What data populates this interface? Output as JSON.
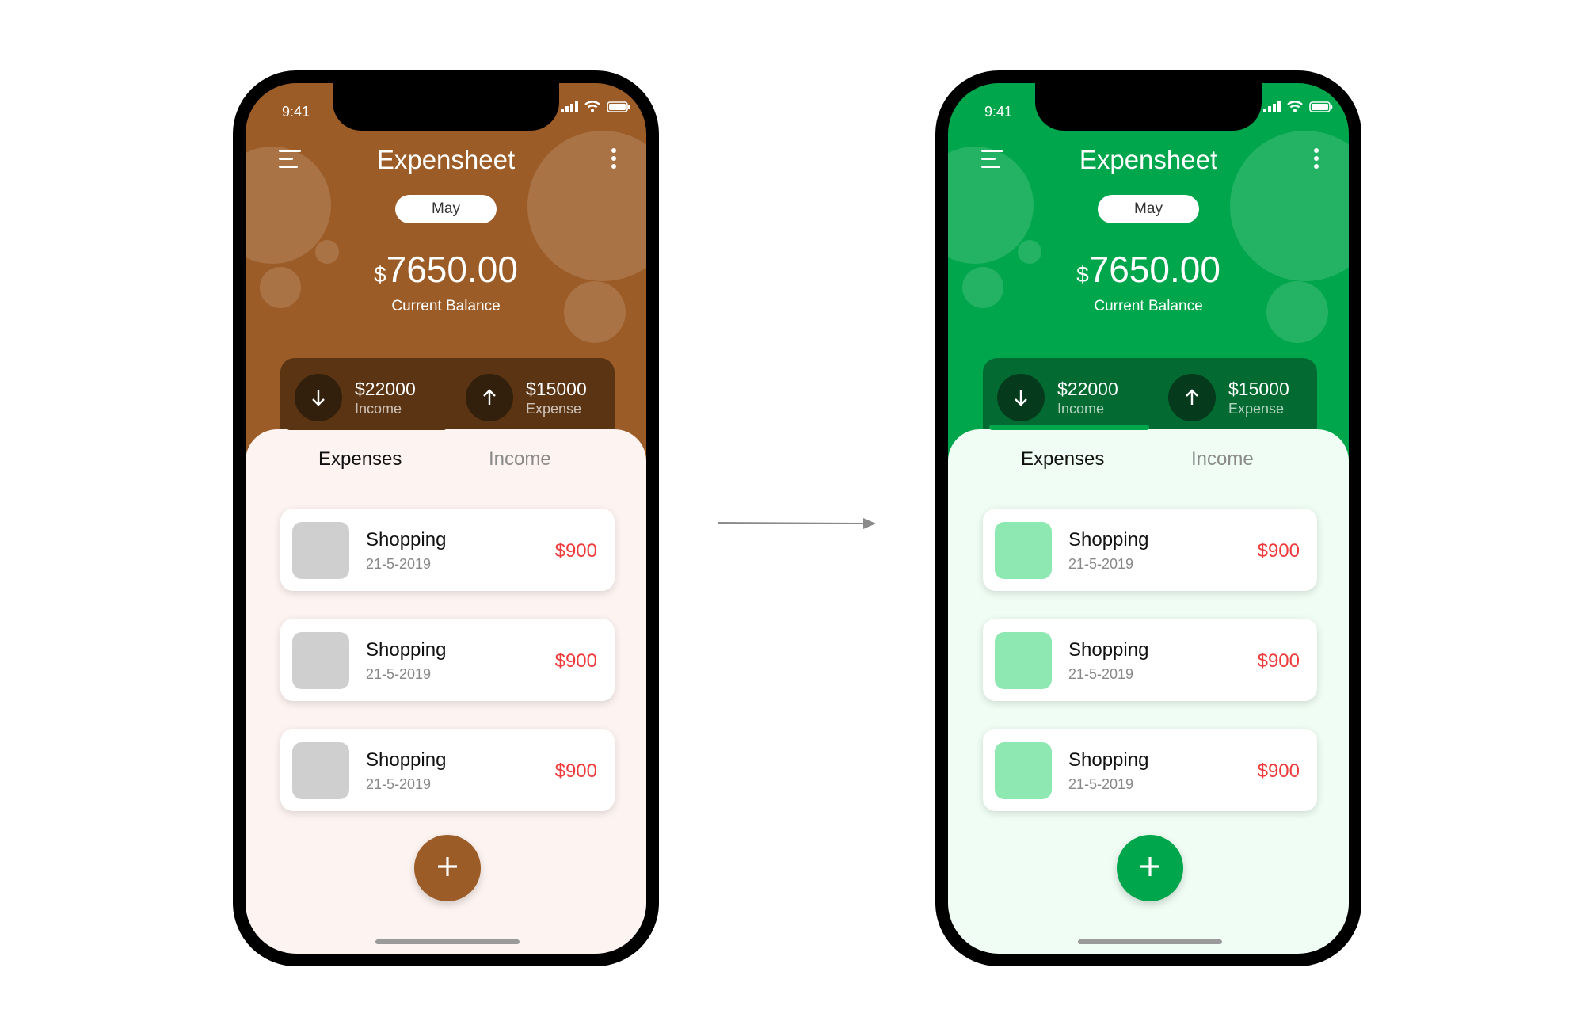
{
  "arrow": {
    "icon": "arrow-right-icon"
  },
  "phones": [
    {
      "theme": {
        "header": "#9c5c27",
        "summary": "#5a3413",
        "circle": "#33200c",
        "panel": "#fdf3f1",
        "thumb": "#cfcfcf",
        "fab": "#9c5c27",
        "indicator": "#5a3413"
      },
      "status": {
        "time": "9:41",
        "icons": [
          "signal-icon",
          "wifi-icon",
          "battery-icon"
        ]
      },
      "app_title": "Expensheet",
      "month": "May",
      "balance": {
        "currency": "$",
        "amount": "7650.00",
        "label": "Current Balance"
      },
      "summary": {
        "income": {
          "amount": "$22000",
          "label": "Income",
          "icon": "arrow-down-icon"
        },
        "expense": {
          "amount": "$15000",
          "label": "Expense",
          "icon": "arrow-up-icon"
        }
      },
      "tabs": {
        "active": "Expenses",
        "inactive": "Income"
      },
      "transactions": [
        {
          "name": "Shopping",
          "date": "21-5-2019",
          "amount": "$900"
        },
        {
          "name": "Shopping",
          "date": "21-5-2019",
          "amount": "$900"
        },
        {
          "name": "Shopping",
          "date": "21-5-2019",
          "amount": "$900"
        }
      ],
      "fab_icon": "plus-icon"
    },
    {
      "theme": {
        "header": "#00a64b",
        "summary": "#036b31",
        "circle": "#053a1c",
        "panel": "#effdf4",
        "thumb": "#8ee8b2",
        "fab": "#00a64b",
        "indicator": "#00a64b"
      },
      "status": {
        "time": "9:41",
        "icons": [
          "signal-icon",
          "wifi-icon",
          "battery-icon"
        ]
      },
      "app_title": "Expensheet",
      "month": "May",
      "balance": {
        "currency": "$",
        "amount": "7650.00",
        "label": "Current Balance"
      },
      "summary": {
        "income": {
          "amount": "$22000",
          "label": "Income",
          "icon": "arrow-down-icon"
        },
        "expense": {
          "amount": "$15000",
          "label": "Expense",
          "icon": "arrow-up-icon"
        }
      },
      "tabs": {
        "active": "Expenses",
        "inactive": "Income"
      },
      "transactions": [
        {
          "name": "Shopping",
          "date": "21-5-2019",
          "amount": "$900"
        },
        {
          "name": "Shopping",
          "date": "21-5-2019",
          "amount": "$900"
        },
        {
          "name": "Shopping",
          "date": "21-5-2019",
          "amount": "$900"
        }
      ],
      "fab_icon": "plus-icon"
    }
  ]
}
